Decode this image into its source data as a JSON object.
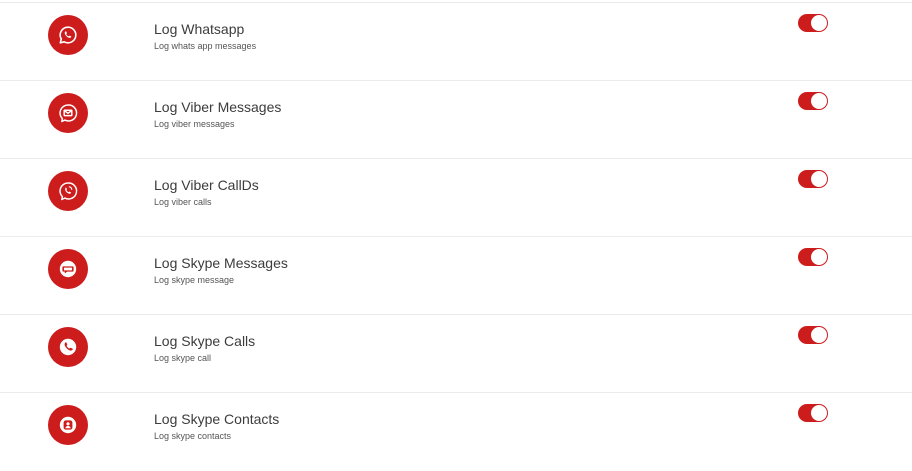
{
  "accent_color": "#cc1c1c",
  "settings": [
    {
      "icon": "whatsapp-icon",
      "title": "Log Whatsapp",
      "subtitle": "Log whats app messages",
      "enabled": true
    },
    {
      "icon": "viber-message-icon",
      "title": "Log Viber Messages",
      "subtitle": "Log viber messages",
      "enabled": true
    },
    {
      "icon": "viber-call-icon",
      "title": "Log Viber CallDs",
      "subtitle": "Log viber calls",
      "enabled": true
    },
    {
      "icon": "skype-message-icon",
      "title": "Log Skype Messages",
      "subtitle": "Log skype message",
      "enabled": true
    },
    {
      "icon": "skype-call-icon",
      "title": "Log Skype Calls",
      "subtitle": "Log skype call",
      "enabled": true
    },
    {
      "icon": "skype-contacts-icon",
      "title": "Log Skype Contacts",
      "subtitle": "Log skype contacts",
      "enabled": true
    }
  ]
}
